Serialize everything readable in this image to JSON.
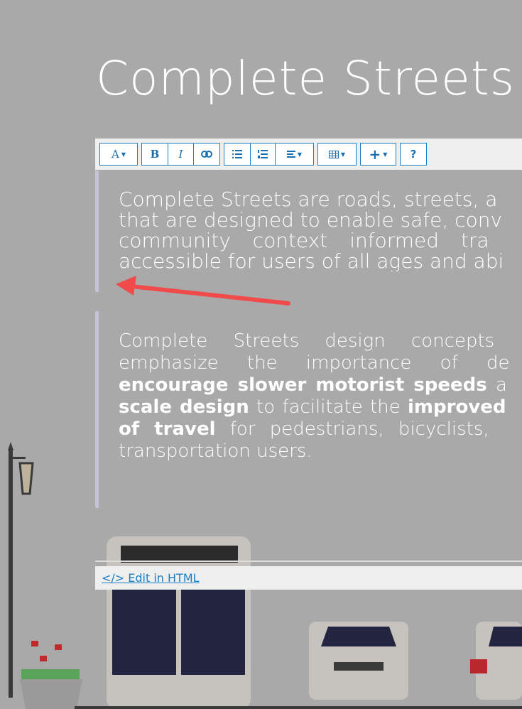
{
  "page": {
    "title": "Complete Streets"
  },
  "toolbar": {
    "font_label": "A",
    "bold_label": "B",
    "italic_label": "I",
    "help_label": "?",
    "icons": [
      "font-icon",
      "bold-icon",
      "italic-icon",
      "link-icon",
      "bullet-list-icon",
      "numbered-list-icon",
      "align-icon",
      "table-icon",
      "insert-plus-icon",
      "help-icon"
    ]
  },
  "content": {
    "paragraph1": [
      "Complete Streets are roads, streets, a",
      "that are designed to enable safe, conv",
      "community context informed tra",
      "accessible for users of all ages and abi"
    ],
    "paragraph2": {
      "l1": "Complete Streets design concepts",
      "l2": "emphasize the importance of de",
      "l3_bold": "encourage slower motorist speeds",
      "l3_rest": " a",
      "l4_bold1": "scale design",
      "l4_mid": " to facilitate the ",
      "l4_bold2": "improved",
      "l5_bold": "of travel",
      "l5_rest": " for pedestrians, bicyclists,",
      "l6": "transportation users."
    }
  },
  "footer": {
    "edit_html_label": "</> Edit in HTML"
  },
  "colors": {
    "accent": "#1a7fc1",
    "arrow": "#f04a4a",
    "background": "#a9a9a9",
    "quote_bar": "#c6c2dc"
  }
}
